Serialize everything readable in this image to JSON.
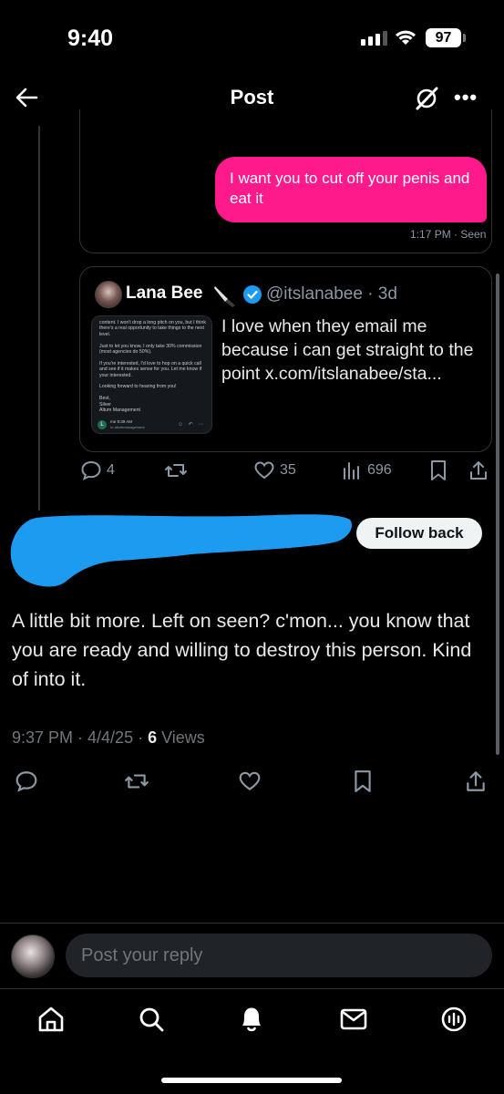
{
  "status_bar": {
    "time": "9:40",
    "battery": "97"
  },
  "header": {
    "title": "Post"
  },
  "dm": {
    "message": "I want you to cut off your penis and eat it",
    "meta": "1:17 PM · Seen"
  },
  "quote": {
    "name": "Lana Bee",
    "handle_time": "@itslanabee · 3d",
    "text": "I love when they email me because i can get straight to the point x.com/itslanabee/sta...",
    "thumbnail": {
      "body": "content. I won't drop a long pitch on you, but I think there's a real opportunity to take things to the next level.\n\nJust to let you know, I only take 30% commission (most agencies do 50%).\n\nIf you're interested, I'd love to hop on a quick call and see if it makes sense for you. Let me know if your interested.\n\nLooking forward to hearing from you!\n\nBest,\nSilver\nAltum Management",
      "avatar_letter": "L",
      "from": "me  9:39 AM",
      "to": "to altummanagement"
    }
  },
  "tweet_actions": {
    "replies": "4",
    "likes": "35",
    "views": "696"
  },
  "author": {
    "follow_label": "Follow back"
  },
  "post": {
    "text": "A little bit more. Left on seen? c'mon... you know that you are ready and willing to destroy this person. Kind of into it.",
    "time_date": "9:37 PM · 4/4/25 · ",
    "views_count": "6",
    "views_label": " Views"
  },
  "reply": {
    "placeholder": "Post your reply"
  },
  "colors": {
    "dm_bubble": "#ff1a8c",
    "verified": "#1d9bf0",
    "scribble": "#1d9bf0"
  }
}
